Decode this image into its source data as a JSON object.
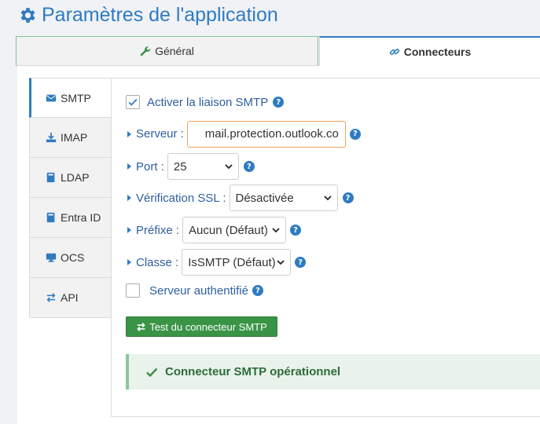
{
  "page": {
    "title": "Paramètres de l'application",
    "title_icon": "gear-icon"
  },
  "top_tabs": [
    {
      "label": "Général",
      "icon": "wrench-icon",
      "active": false
    },
    {
      "label": "Connecteurs",
      "icon": "link-icon",
      "active": true
    }
  ],
  "side_tabs": [
    {
      "label": "SMTP",
      "icon": "envelope-icon",
      "active": true
    },
    {
      "label": "IMAP",
      "icon": "download-icon",
      "active": false
    },
    {
      "label": "LDAP",
      "icon": "book-icon",
      "active": false
    },
    {
      "label": "Entra ID",
      "icon": "book-icon",
      "active": false
    },
    {
      "label": "OCS",
      "icon": "desktop-icon",
      "active": false
    },
    {
      "label": "API",
      "icon": "exchange-icon",
      "active": false
    }
  ],
  "smtp": {
    "enable_label": "Activer la liaison SMTP",
    "enable_checked": true,
    "server_label": "Serveur :",
    "server_value": "mail.protection.outlook.co",
    "port_label": "Port :",
    "port_value": "25",
    "ssl_label": "Vérification SSL :",
    "ssl_value": "Désactivée",
    "prefix_label": "Préfixe :",
    "prefix_value": "Aucun (Défaut)",
    "class_label": "Classe :",
    "class_value": "IsSMTP (Défaut)",
    "auth_label": "Serveur authentifié",
    "auth_checked": false,
    "test_button": "Test du connecteur SMTP",
    "status_message": "Connecteur SMTP opérationnel"
  },
  "colors": {
    "primary": "#2f7bc2",
    "success_button": "#3a9446",
    "success_bg": "#e9f3eb",
    "success_text": "#2e6b3a",
    "focus_border": "#f0a45a"
  }
}
